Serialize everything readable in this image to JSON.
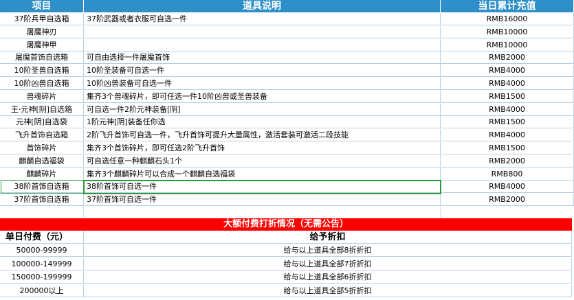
{
  "header": {
    "col_item": "项目",
    "col_desc": "道具说明",
    "col_amount": "当日累计充值"
  },
  "items": [
    {
      "name": "37阶兵甲自选箱",
      "desc": "37阶武器或者衣服可自选一件",
      "amount": "RMB16000"
    },
    {
      "name": "屠魔神刃",
      "desc": "",
      "amount": "RMB10000"
    },
    {
      "name": "屠魔神甲",
      "desc": "",
      "amount": "RMB10000"
    },
    {
      "name": "屠魔首饰自选箱",
      "desc": "可自由选择一件屠魔首饰",
      "amount": "RMB2000"
    },
    {
      "name": "10阶圣兽自选箱",
      "desc": "10阶圣装备可自选一件",
      "amount": "RMB4000"
    },
    {
      "name": "10阶凶兽自选箱",
      "desc": "10阶凶兽装备可自选一件",
      "amount": "RMB4000"
    },
    {
      "name": "兽魂碎片",
      "desc": "集齐3个兽魂碎片，即可任选一件10阶凶兽或圣兽装备",
      "amount": "RMB1500"
    },
    {
      "name": "王·元神[阴]自选箱",
      "desc": "可自选一件2阶元神装备[阴]",
      "amount": "RMB4000"
    },
    {
      "name": "元神[阴]自选袋",
      "desc": "1阶元神[阴]装备任你选",
      "amount": "RMB1500"
    },
    {
      "name": "飞升首饰自选箱",
      "desc": "2阶飞升首饰可自选一件，飞升首饰可提升大量属性，激活套装可激活二段技能",
      "amount": "RMB4000"
    },
    {
      "name": "首饰碎片",
      "desc": "集齐3个首饰碎片，即可任选2阶飞升首饰",
      "amount": "RMB1500"
    },
    {
      "name": "麒麟自选福袋",
      "desc": "可自选任意一种麒麟石头1个",
      "amount": "RMB2000"
    },
    {
      "name": "麒麟碎片",
      "desc": "集齐3个麒麟碎片可以合成一个麒麟自选福袋",
      "amount": "RMB800"
    },
    {
      "name": "38阶首饰自选箱",
      "desc": "38阶首饰可自选一件",
      "amount": "RMB4000"
    },
    {
      "name": "37阶首饰自选箱",
      "desc": "37阶首饰可自选一件",
      "amount": "RMB2000"
    }
  ],
  "discount": {
    "title": "大额付费打折情况（无需公告）",
    "col_pay": "单日付费（元）",
    "col_discount": "给予折扣",
    "rows": [
      {
        "range": "50000-99999",
        "discount": "给与以上道具全部8折折扣"
      },
      {
        "range": "100000-149999",
        "discount": "给与以上道具全部7折折扣"
      },
      {
        "range": "150000-199999",
        "discount": "给与以上道具全部6折折扣"
      },
      {
        "range": "200000以上",
        "discount": "给与以上道具全部5折折扣"
      }
    ]
  },
  "colors": {
    "header_bg": "#2e8fc9",
    "banner_bg": "#ff0000",
    "selection": "#2e9a3a",
    "grid": "#b7cfe3"
  }
}
